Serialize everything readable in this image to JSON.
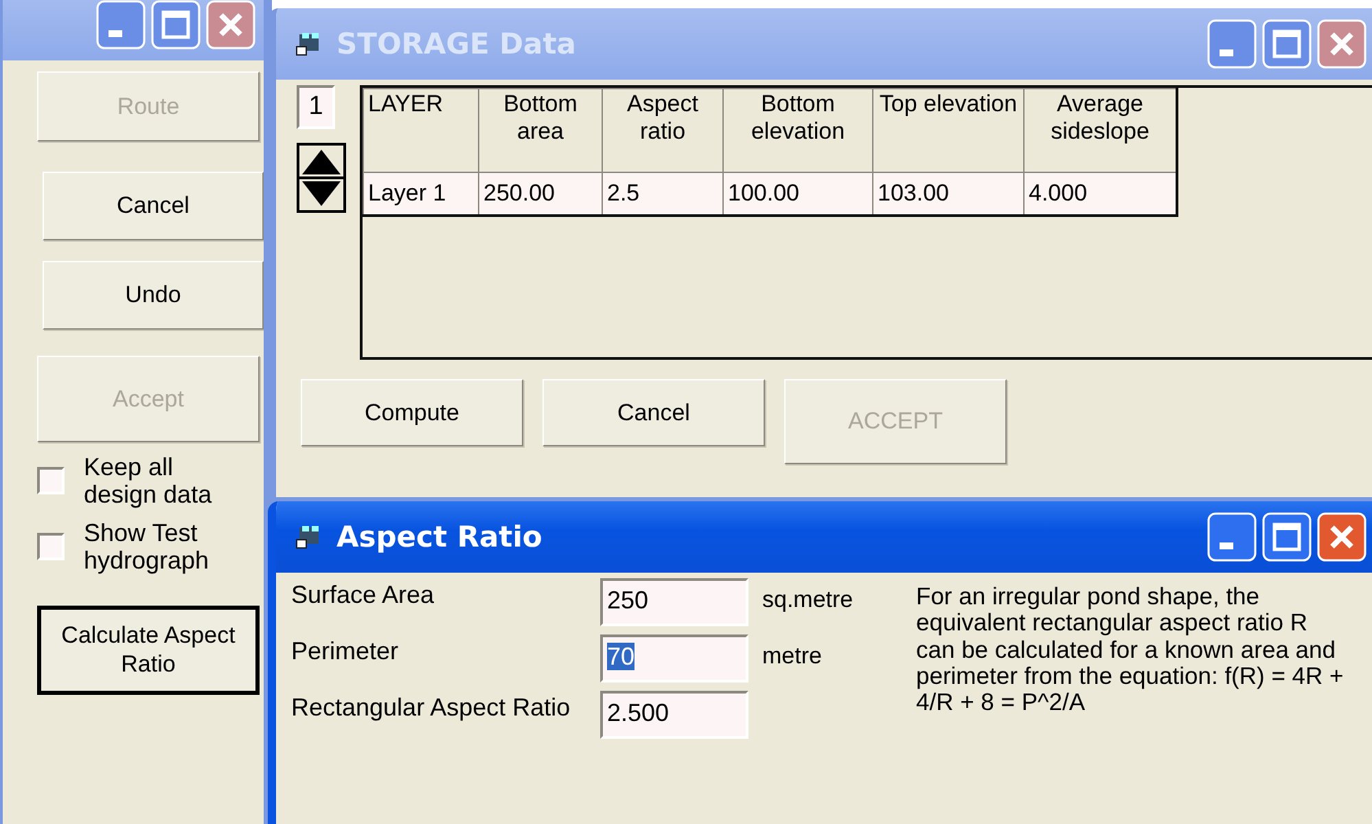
{
  "side_window": {
    "active": false,
    "buttons": [
      {
        "label": "Route",
        "disabled": true
      },
      {
        "label": "Cancel",
        "disabled": false
      },
      {
        "label": "Undo",
        "disabled": false
      },
      {
        "label": "Accept",
        "disabled": true
      }
    ],
    "checkboxes": [
      {
        "label": "Keep all design data",
        "checked": false
      },
      {
        "label": "Show Test hydrograph",
        "checked": false
      }
    ],
    "calculate_button": {
      "label": "Calculate Aspect Ratio",
      "default": true
    }
  },
  "storage_window": {
    "title": "STORAGE Data",
    "active": false,
    "layer_counter": "1",
    "table": {
      "columns": [
        "LAYER",
        "Bottom area",
        "Aspect ratio",
        "Bottom elevation",
        "Top elevation",
        "Average sideslope"
      ],
      "rows": [
        [
          "Layer 1",
          "250.00",
          "2.5",
          "100.00",
          "103.00",
          "4.000"
        ]
      ]
    },
    "buttons": [
      {
        "label": "Compute",
        "disabled": false
      },
      {
        "label": "Cancel",
        "disabled": false
      },
      {
        "label": "ACCEPT",
        "disabled": true
      }
    ]
  },
  "aspect_window": {
    "title": "Aspect Ratio",
    "active": true,
    "fields": [
      {
        "label": "Surface Area",
        "value": "250",
        "unit": "sq.metre",
        "selected": false
      },
      {
        "label": "Perimeter",
        "value": "70",
        "unit": "metre",
        "selected": true
      },
      {
        "label": "Rectangular Aspect Ratio",
        "value": "2.500",
        "selected": false
      }
    ],
    "description": "For an irregular pond shape, the equivalent rectangular aspect ratio R can be calculated for a known area and perimeter from the equation: f(R) = 4R + 4/R + 8 = P^2/A"
  }
}
